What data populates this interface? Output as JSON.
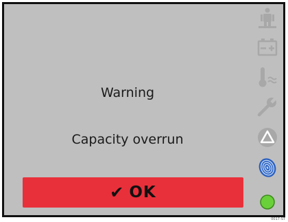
{
  "dialog": {
    "title": "Warning",
    "message": "Capacity overrun",
    "ok_label": "OK",
    "ok_check": "✔"
  },
  "status_icons": [
    {
      "name": "patient-icon",
      "state": "inactive"
    },
    {
      "name": "battery-icon",
      "state": "inactive"
    },
    {
      "name": "temperature-icon",
      "state": "inactive"
    },
    {
      "name": "wrench-icon",
      "state": "inactive"
    },
    {
      "name": "alert-triangle-icon",
      "state": "inactive"
    },
    {
      "name": "fingerprint-icon",
      "state": "active"
    },
    {
      "name": "status-led-icon",
      "state": "ok"
    }
  ],
  "colors": {
    "screen_background": "#bfbfbf",
    "ok_button": "#e8303a",
    "icon_inactive": "#a8a8a8",
    "fingerprint_active": "#2a5fbf",
    "status_led": "#6ad03a"
  },
  "corner_code": "0017-ST"
}
